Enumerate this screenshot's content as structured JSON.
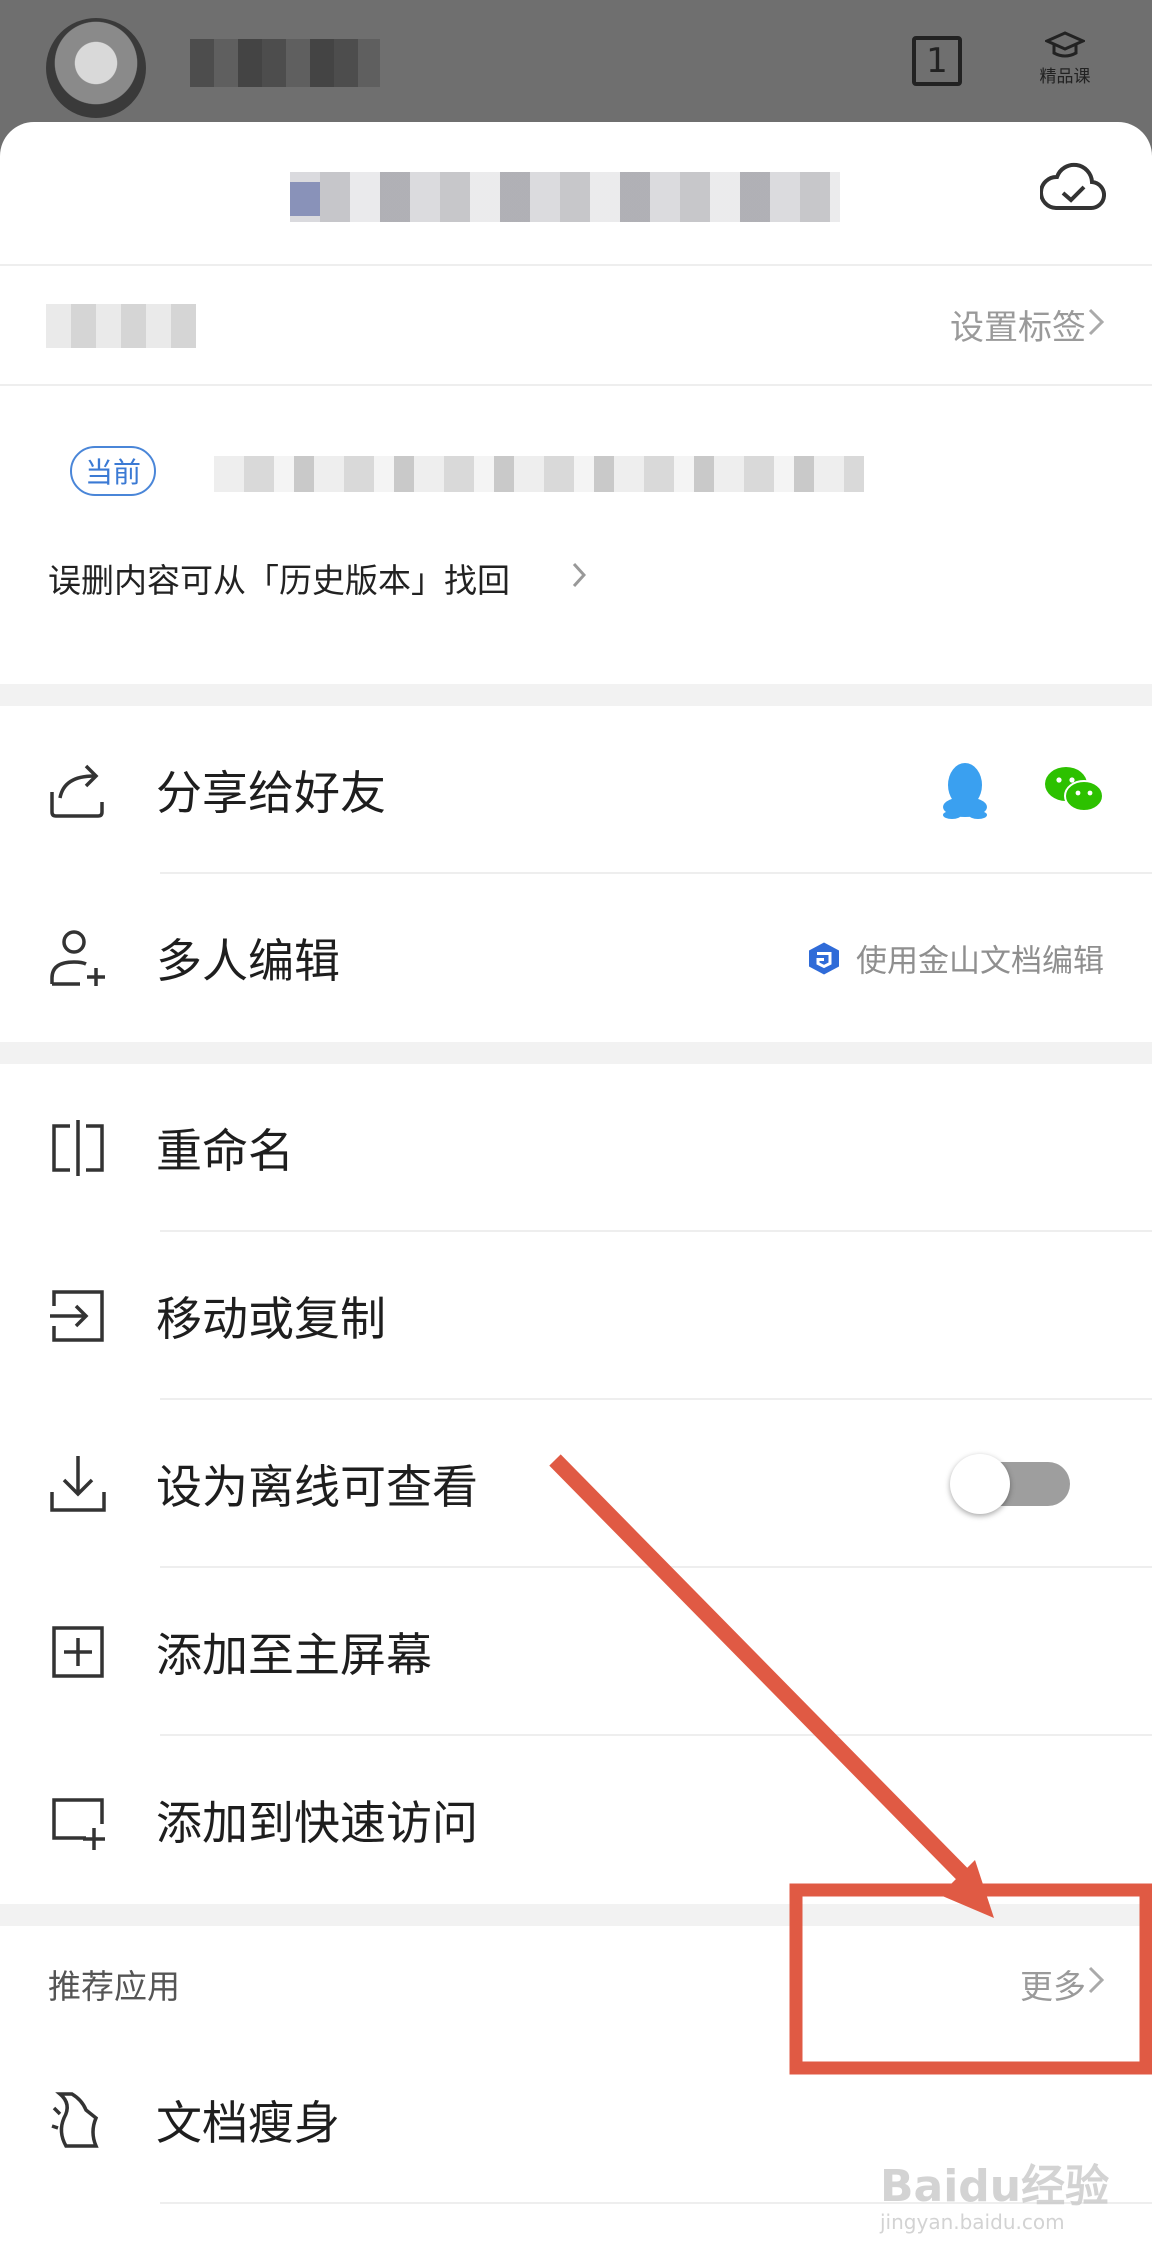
{
  "topbar": {
    "badge_num": "1",
    "course_label": "精品课"
  },
  "sheet": {
    "tag_action": "设置标签",
    "version_pill": "当前",
    "restore_hint": "误删内容可从「历史版本」找回"
  },
  "menu_group1": [
    {
      "label": "分享给好友"
    },
    {
      "label": "多人编辑",
      "right": "使用金山文档编辑"
    }
  ],
  "menu_group2": [
    {
      "label": "重命名"
    },
    {
      "label": "移动或复制"
    },
    {
      "label": "设为离线可查看",
      "toggle": "off"
    },
    {
      "label": "添加至主屏幕"
    },
    {
      "label": "添加到快速访问"
    }
  ],
  "recommend": {
    "title": "推荐应用",
    "more": "更多",
    "items": [
      {
        "label": "文档瘦身"
      }
    ]
  },
  "watermark": {
    "brand": "Baidu经验",
    "url": "jingyan.baidu.com"
  },
  "colors": {
    "annotation": "#e05a44",
    "accent": "#3b7ad4",
    "qq": "#3aa0f0",
    "wechat": "#2dc100"
  }
}
